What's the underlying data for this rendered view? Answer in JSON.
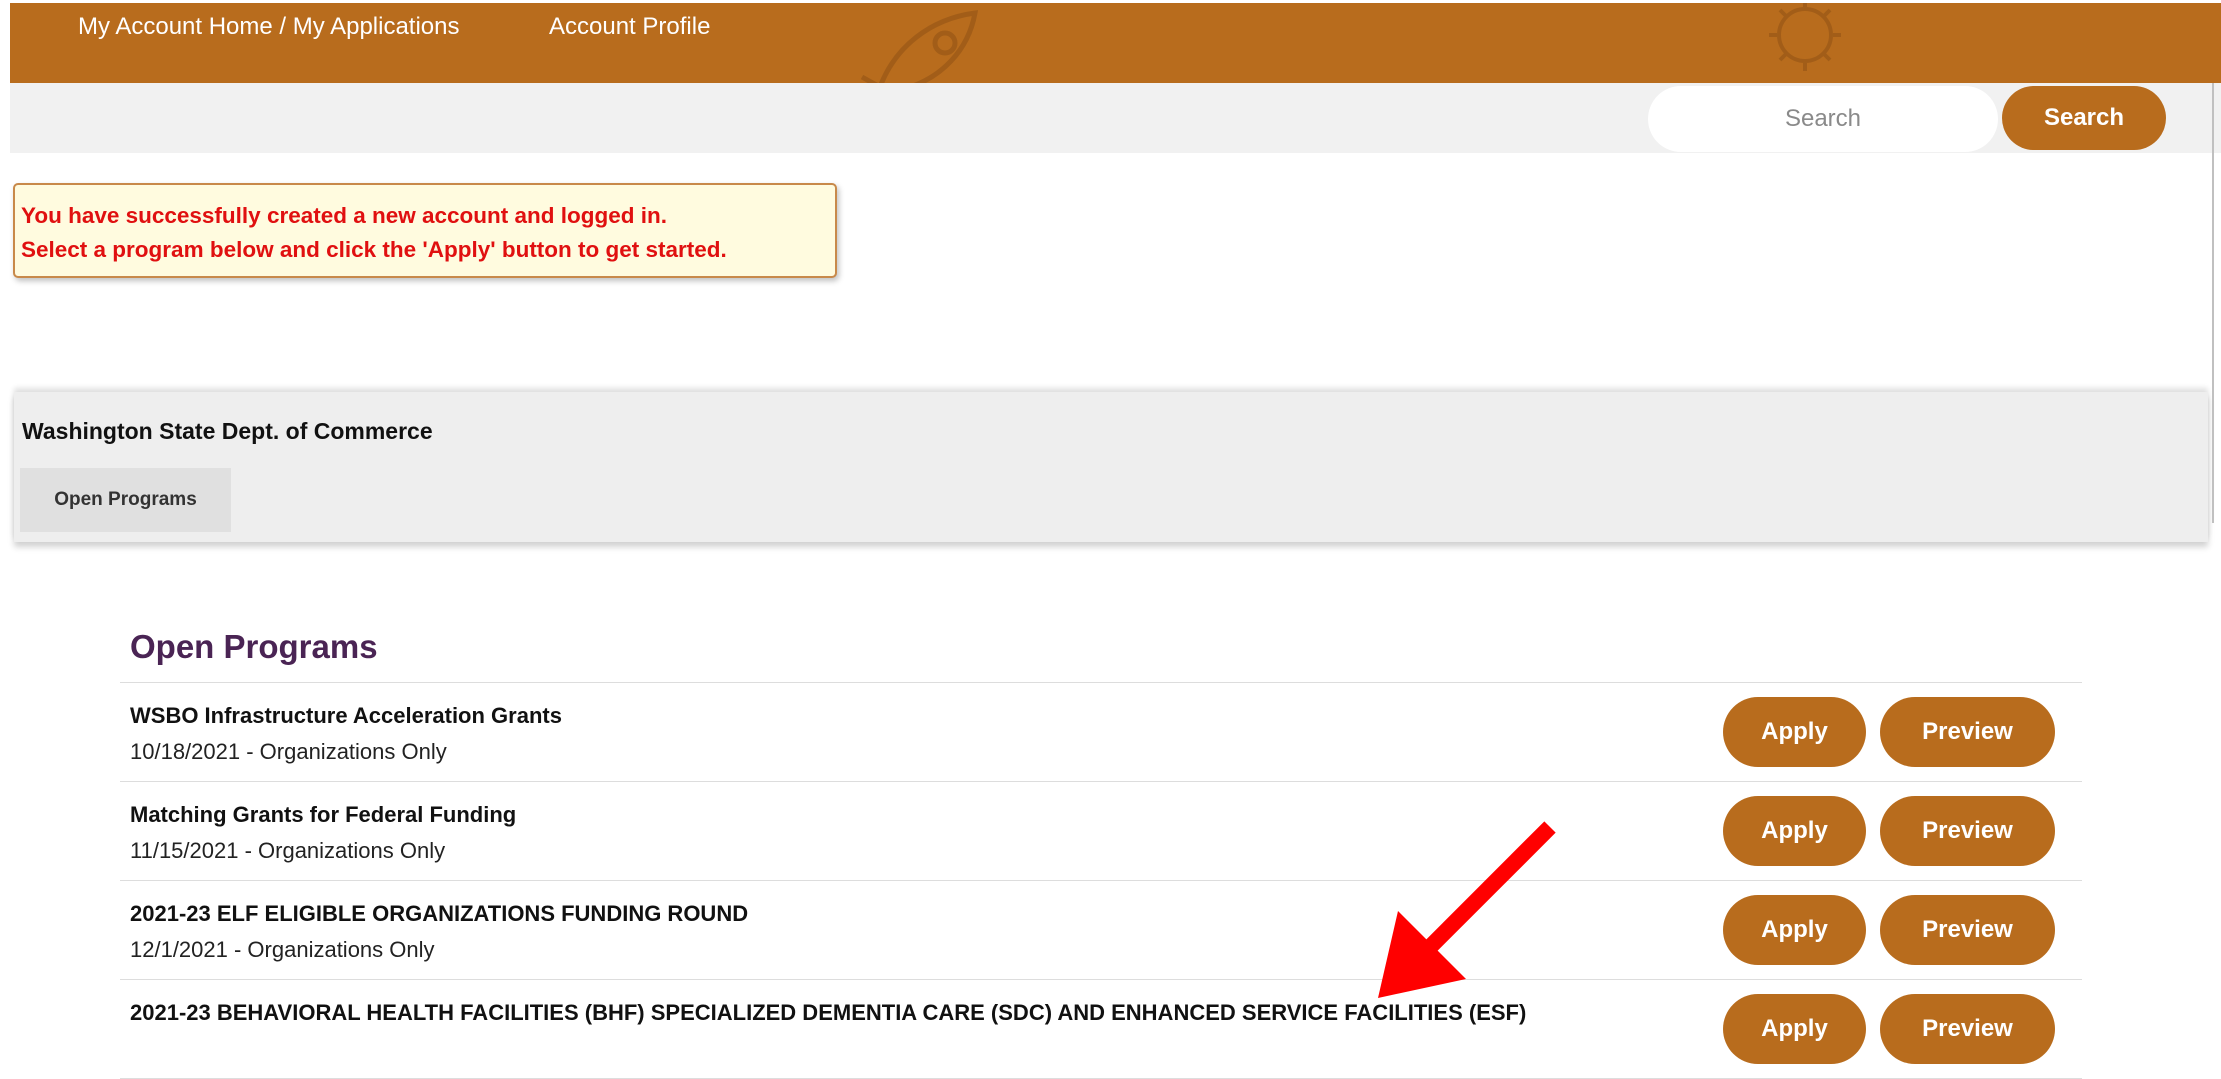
{
  "nav": {
    "home_label": "My Account Home / My Applications",
    "profile_label": "Account Profile"
  },
  "search": {
    "placeholder": "Search",
    "button_label": "Search"
  },
  "alert": {
    "line1": "You have successfully created a new account and logged in.",
    "line2": "Select a program below and click the 'Apply' button to get started."
  },
  "organization": {
    "name": "Washington State Dept. of Commerce",
    "tab_label": "Open Programs"
  },
  "programs_section": {
    "title": "Open Programs",
    "items": [
      {
        "title": "WSBO Infrastructure Acceleration Grants",
        "meta": "10/18/2021 - Organizations Only",
        "apply_label": "Apply",
        "preview_label": "Preview"
      },
      {
        "title": "Matching Grants for Federal Funding",
        "meta": "11/15/2021 - Organizations Only",
        "apply_label": "Apply",
        "preview_label": "Preview"
      },
      {
        "title": "2021-23 ELF ELIGIBLE ORGANIZATIONS FUNDING ROUND",
        "meta": "12/1/2021 - Organizations Only",
        "apply_label": "Apply",
        "preview_label": "Preview"
      },
      {
        "title": "2021-23 BEHAVIORAL HEALTH FACILITIES (BHF) SPECIALIZED DEMENTIA CARE (SDC) AND ENHANCED SERVICE FACILITIES (ESF)",
        "meta": "",
        "apply_label": "Apply",
        "preview_label": "Preview"
      }
    ]
  },
  "colors": {
    "brand": "#b86c1d",
    "alert_text": "#e01010",
    "section_title": "#4a2454",
    "annotation_arrow": "#ff0000"
  },
  "icons": [
    "rocket-icon",
    "gear-icon",
    "annotation-arrow-icon"
  ]
}
